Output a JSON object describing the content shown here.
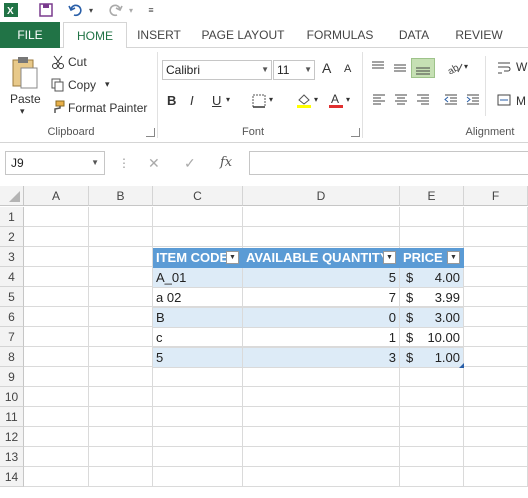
{
  "qat": {
    "icons": [
      "excel-logo-icon",
      "save-icon",
      "undo-icon",
      "redo-icon",
      "customize-qat-icon"
    ]
  },
  "tabs": [
    {
      "label": "FILE"
    },
    {
      "label": "HOME"
    },
    {
      "label": "INSERT"
    },
    {
      "label": "PAGE LAYOUT"
    },
    {
      "label": "FORMULAS"
    },
    {
      "label": "DATA"
    },
    {
      "label": "REVIEW"
    }
  ],
  "ribbon": {
    "clipboard": {
      "paste": "Paste",
      "cut": "Cut",
      "copy": "Copy",
      "format_painter": "Format Painter",
      "label": "Clipboard"
    },
    "font": {
      "font_name": "Calibri",
      "font_size": "11",
      "label": "Font",
      "bold": "B",
      "italic": "I",
      "underline": "U",
      "grow": "A",
      "shrink": "A"
    },
    "alignment": {
      "label": "Alignment",
      "wrap_partial": "W",
      "merge_partial": "M"
    }
  },
  "formula_bar": {
    "name_box": "J9",
    "fx": "fx",
    "formula": ""
  },
  "columns": [
    "A",
    "B",
    "C",
    "D",
    "E",
    "F"
  ],
  "rows": [
    "1",
    "2",
    "3",
    "4",
    "5",
    "6",
    "7",
    "8",
    "9",
    "10",
    "11",
    "12",
    "13",
    "14"
  ],
  "table": {
    "headers": [
      "ITEM CODE",
      "AVAILABLE QUANTITY",
      "PRICE"
    ],
    "rows": [
      {
        "code": "A_01",
        "qty": "5",
        "cur": "$",
        "price": "4.00"
      },
      {
        "code": "a 02",
        "qty": "7",
        "cur": "$",
        "price": "3.99"
      },
      {
        "code": "B",
        "qty": "0",
        "cur": "$",
        "price": "3.00"
      },
      {
        "code": "c",
        "qty": "1",
        "cur": "$",
        "price": "10.00"
      },
      {
        "code": "5",
        "qty": "3",
        "cur": "$",
        "price": "1.00"
      }
    ]
  },
  "colors": {
    "brand_green": "#217346",
    "table_header": "#5b9bd5",
    "table_band": "#ddebf7",
    "font_color_red": "#e03030",
    "highlight_yellow": "#ffff00"
  }
}
